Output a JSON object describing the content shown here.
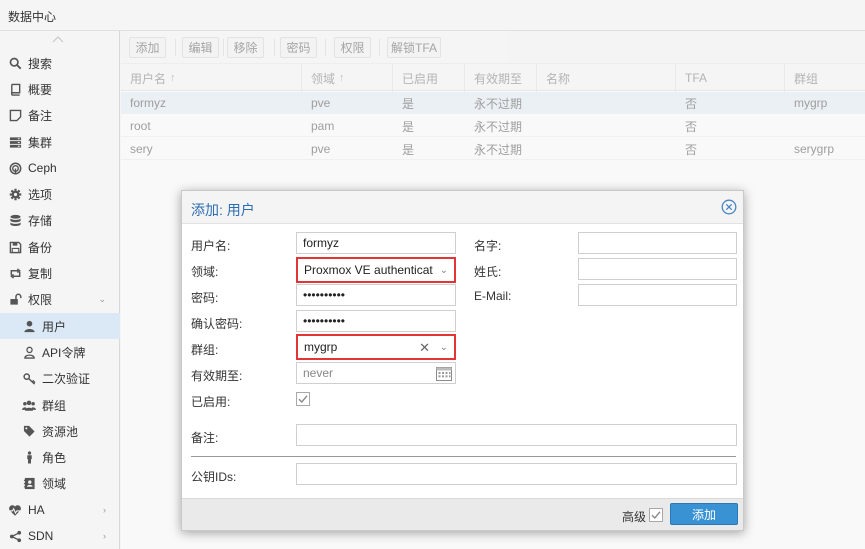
{
  "app": {
    "title": "数据中心"
  },
  "sidebar": {
    "items": [
      {
        "label": "搜索",
        "icon": "search-icon",
        "sub": false,
        "selected": false,
        "arrow": false
      },
      {
        "label": "概要",
        "icon": "book-icon",
        "sub": false,
        "selected": false,
        "arrow": false
      },
      {
        "label": "备注",
        "icon": "note-icon",
        "sub": false,
        "selected": false,
        "arrow": false
      },
      {
        "label": "集群",
        "icon": "server-icon",
        "sub": false,
        "selected": false,
        "arrow": false
      },
      {
        "label": "Ceph",
        "icon": "ceph-icon",
        "sub": false,
        "selected": false,
        "arrow": false
      },
      {
        "label": "选项",
        "icon": "gear-icon",
        "sub": false,
        "selected": false,
        "arrow": false
      },
      {
        "label": "存储",
        "icon": "database-icon",
        "sub": false,
        "selected": false,
        "arrow": false
      },
      {
        "label": "备份",
        "icon": "floppy-icon",
        "sub": false,
        "selected": false,
        "arrow": false
      },
      {
        "label": "复制",
        "icon": "retweet-icon",
        "sub": false,
        "selected": false,
        "arrow": false
      },
      {
        "label": "权限",
        "icon": "unlock-icon",
        "sub": false,
        "selected": false,
        "arrow": true
      },
      {
        "label": "用户",
        "icon": "user-icon",
        "sub": true,
        "selected": true,
        "arrow": false
      },
      {
        "label": "API令牌",
        "icon": "user-outline-icon",
        "sub": true,
        "selected": false,
        "arrow": false
      },
      {
        "label": "二次验证",
        "icon": "key-icon",
        "sub": true,
        "selected": false,
        "arrow": false
      },
      {
        "label": "群组",
        "icon": "users-icon",
        "sub": true,
        "selected": false,
        "arrow": false
      },
      {
        "label": "资源池",
        "icon": "tags-icon",
        "sub": true,
        "selected": false,
        "arrow": false
      },
      {
        "label": "角色",
        "icon": "male-icon",
        "sub": true,
        "selected": false,
        "arrow": false
      },
      {
        "label": "领域",
        "icon": "address-book-icon",
        "sub": true,
        "selected": false,
        "arrow": false
      },
      {
        "label": "HA",
        "icon": "heartbeat-icon",
        "sub": false,
        "selected": false,
        "arrow": true
      },
      {
        "label": "SDN",
        "icon": "share-icon",
        "sub": false,
        "selected": false,
        "arrow": true
      }
    ]
  },
  "toolbar": {
    "add": "添加",
    "edit": "编辑",
    "remove": "移除",
    "password": "密码",
    "permissions": "权限",
    "unlock_tfa": "解锁TFA"
  },
  "grid": {
    "columns": [
      "用户名",
      "领域",
      "已启用",
      "有效期至",
      "名称",
      "TFA",
      "群组"
    ],
    "sort_indicator": "↑",
    "rows": [
      [
        "formyz",
        "pve",
        "是",
        "永不过期",
        "",
        "否",
        "mygrp"
      ],
      [
        "root",
        "pam",
        "是",
        "永不过期",
        "",
        "否",
        ""
      ],
      [
        "sery",
        "pve",
        "是",
        "永不过期",
        "",
        "否",
        "serygrp"
      ]
    ]
  },
  "dialog": {
    "title": "添加: 用户",
    "labels": {
      "username": "用户名:",
      "realm": "领域:",
      "password": "密码:",
      "confirm_password": "确认密码:",
      "group": "群组:",
      "expire": "有效期至:",
      "enabled": "已启用:",
      "firstname": "名字:",
      "lastname": "姓氏:",
      "email": "E-Mail:",
      "comment": "备注:",
      "keys": "公钥IDs:"
    },
    "values": {
      "username": "formyz",
      "realm": "Proxmox VE authenticat",
      "password": "••••••••••",
      "confirm_password": "••••••••••",
      "group": "mygrp",
      "expire_placeholder": "never",
      "firstname": "",
      "lastname": "",
      "email": "",
      "comment": "",
      "keys": ""
    },
    "footer": {
      "advanced": "高级",
      "add": "添加"
    }
  },
  "colors": {
    "accent": "#3892d4",
    "title_blue": "#2d6db0",
    "highlight_red": "#e23535",
    "selection": "#dbe8f6"
  }
}
